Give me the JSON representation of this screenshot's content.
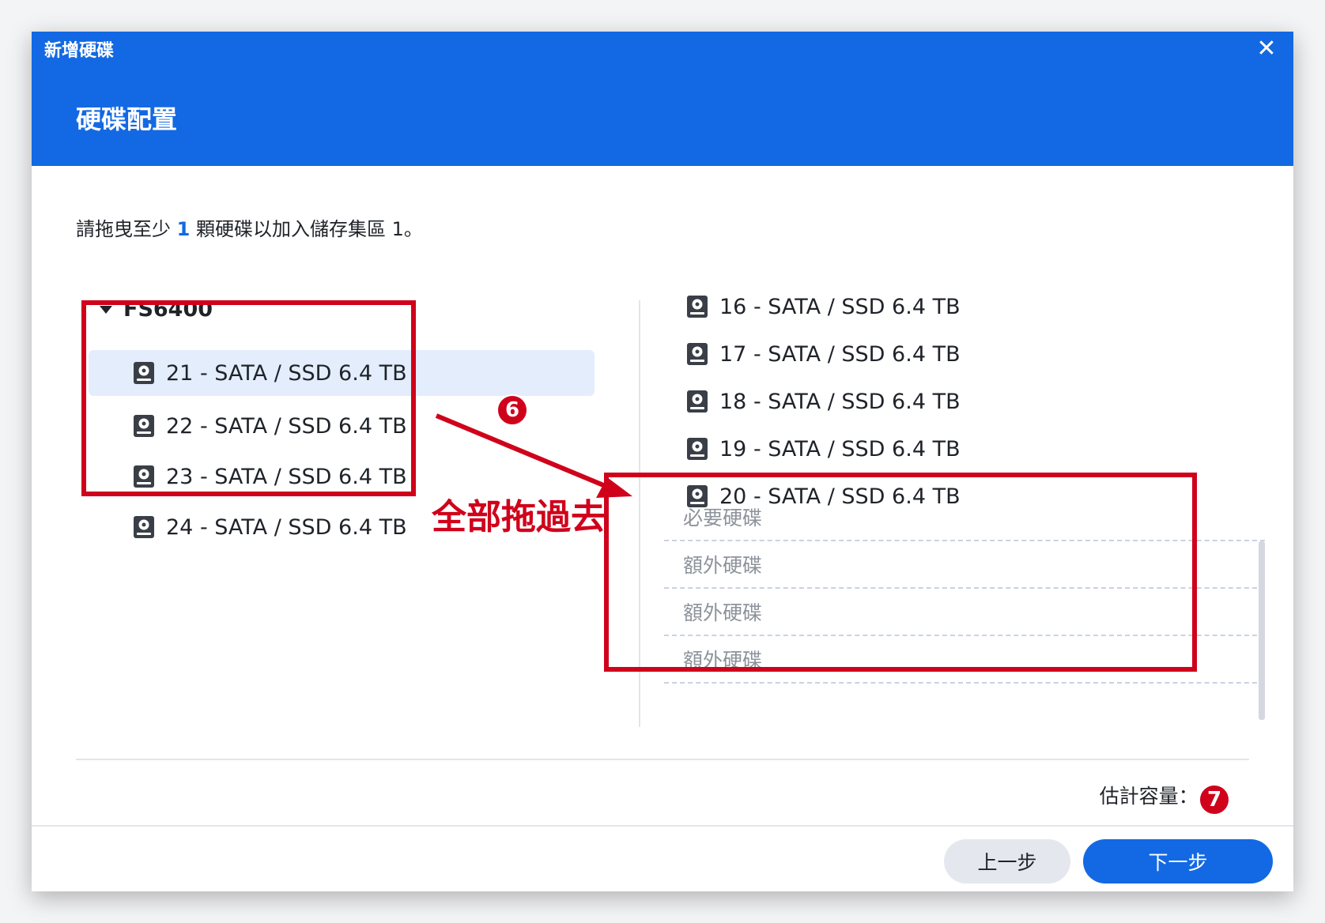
{
  "dialog": {
    "window_title": "新增硬碟",
    "step_title": "硬碟配置",
    "close_icon": "close-icon"
  },
  "instruction": {
    "prefix": "請拖曳至少",
    "count": "1",
    "suffix": "顆硬碟以加入儲存集區 1。"
  },
  "left_group": {
    "name": "FS6400",
    "disks": [
      {
        "label": "21 - SATA / SSD 6.4 TB",
        "selected": true
      },
      {
        "label": "22 - SATA / SSD 6.4 TB",
        "selected": false
      },
      {
        "label": "23 - SATA / SSD 6.4 TB",
        "selected": false
      },
      {
        "label": "24 - SATA / SSD 6.4 TB",
        "selected": false
      }
    ]
  },
  "right_panel": {
    "disks": [
      {
        "label": "16 - SATA / SSD 6.4 TB"
      },
      {
        "label": "17 - SATA / SSD 6.4 TB"
      },
      {
        "label": "18 - SATA / SSD 6.4 TB"
      },
      {
        "label": "19 - SATA / SSD 6.4 TB"
      },
      {
        "label": "20 - SATA / SSD 6.4 TB"
      }
    ],
    "slots": [
      {
        "label": "必要硬碟"
      },
      {
        "label": "額外硬碟"
      },
      {
        "label": "額外硬碟"
      },
      {
        "label": "額外硬碟"
      }
    ]
  },
  "capacity": {
    "label": "估計容量：",
    "value": "-"
  },
  "footer": {
    "back_label": "上一步",
    "next_label": "下一步"
  },
  "annotations": {
    "drag_label": "全部拖過去",
    "step6": "6",
    "step7": "7",
    "color": "#d0021b"
  },
  "colors": {
    "header": "#1369e3",
    "selected_row": "#e3edfc",
    "accent": "#1369e3"
  }
}
